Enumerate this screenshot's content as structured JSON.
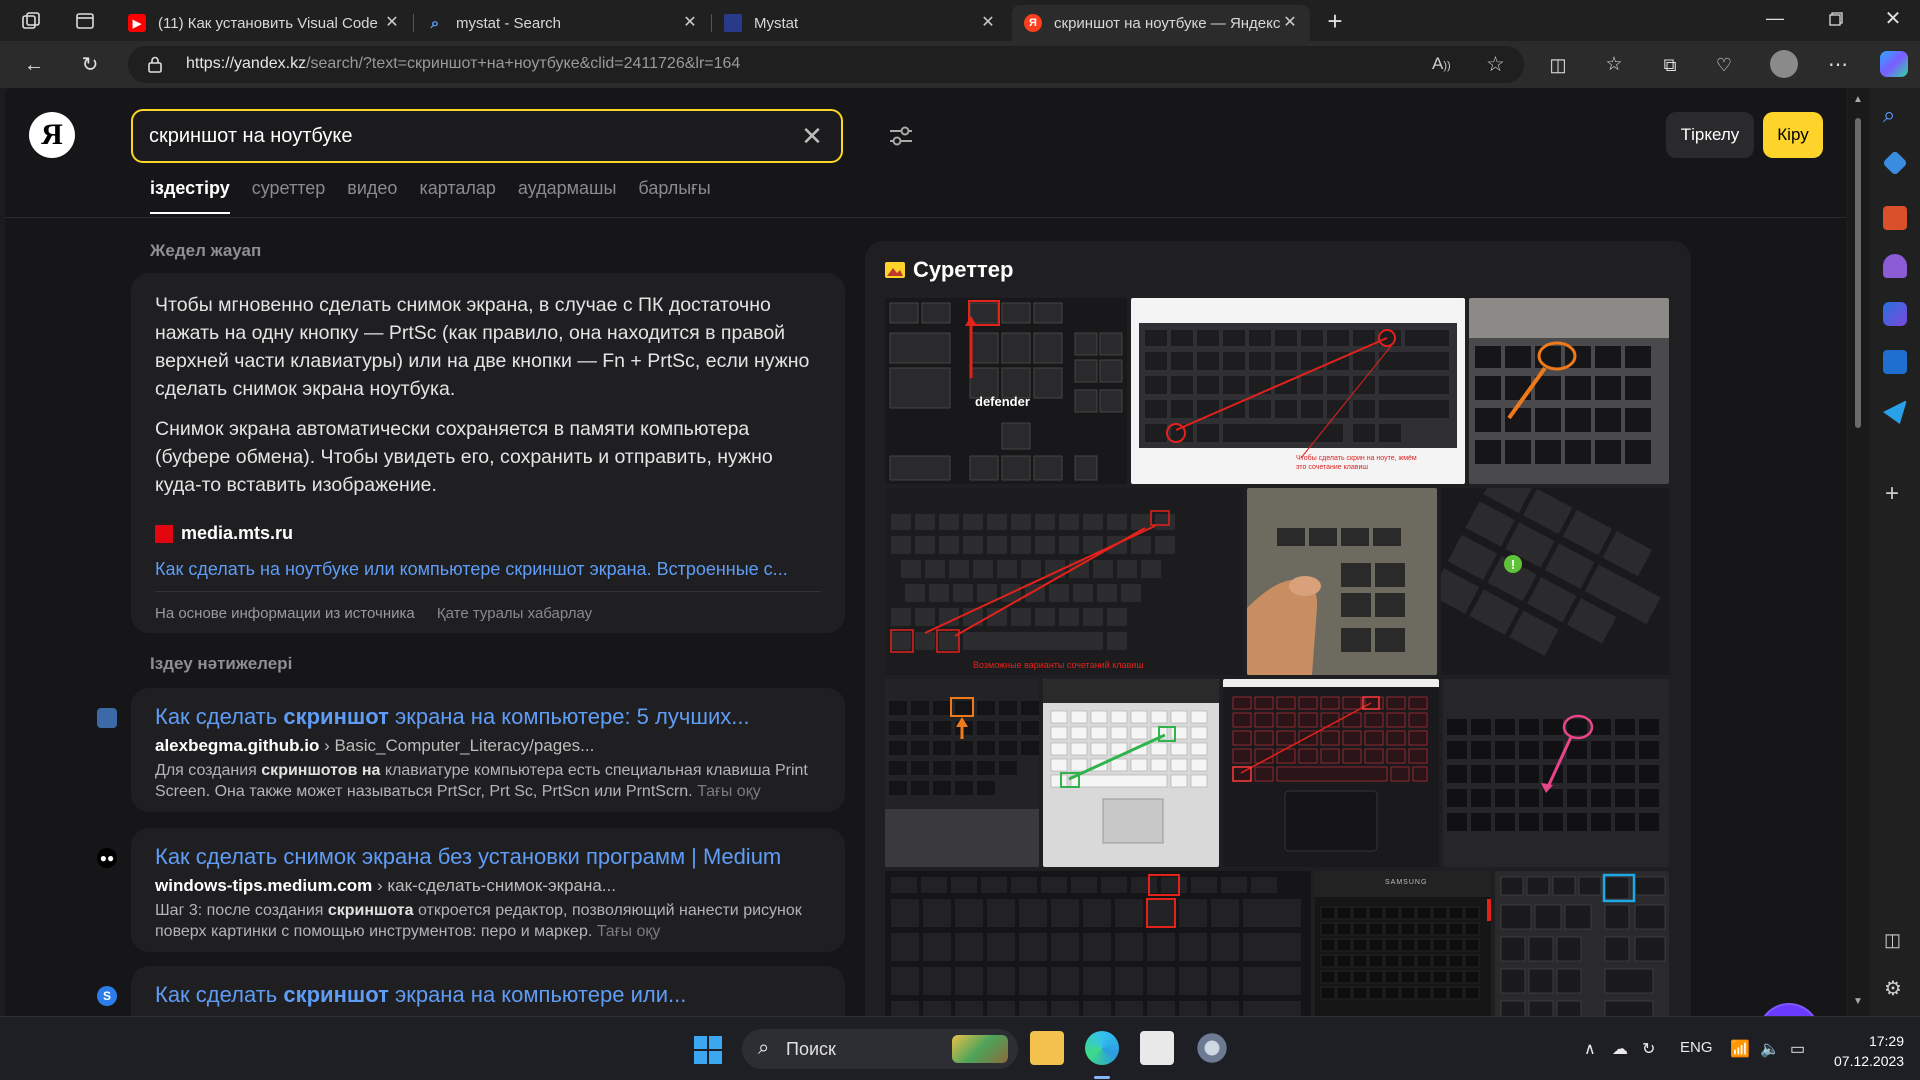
{
  "browser": {
    "tabs": [
      {
        "title": "(11) Как установить Visual Code",
        "favicon": "youtube-icon"
      },
      {
        "title": "mystat - Search",
        "favicon": "search-icon"
      },
      {
        "title": "Mystat",
        "favicon": "mystat-icon"
      },
      {
        "title": "скриншот на ноутбуке — Яндекс",
        "favicon": "yandex-icon",
        "active": true
      }
    ],
    "url_host": "https://yandex.kz",
    "url_rest": "/search/?text=скриншот+на+ноутбуке&clid=2411726&lr=164"
  },
  "header": {
    "logo": "Я",
    "query": "скриншот на ноутбуке",
    "tabs": [
      "іздестіру",
      "суреттер",
      "видео",
      "карталар",
      "аудармашы",
      "барлығы"
    ],
    "register_label": "Тіркелу",
    "login_label": "Кіру"
  },
  "quick_answer": {
    "heading": "Жедел жауап",
    "paragraph1": "Чтобы мгновенно сделать снимок экрана, в случае с ПК достаточно нажать на одну кнопку — PrtSc (как правило, она находится в правой верхней части клавиатуры) или на две кнопки — Fn + PrtSc, если нужно сделать снимок экрана ноутбука.",
    "paragraph2": "Снимок экрана автоматически сохраняется в памяти компьютера (буфере обмена). Чтобы увидеть его, сохранить и отправить, нужно куда-то вставить изображение.",
    "source_domain": "media.mts.ru",
    "source_link": "Как сделать на ноутбуке или компьютере скриншот экрана. Встроенные с...",
    "footer_info": "На основе информации из источника",
    "footer_report": "Қате туралы хабарлау"
  },
  "results": {
    "heading": "Іздеу нәтижелері",
    "items": [
      {
        "title_pre": "Как сделать ",
        "title_bold": "скриншот",
        "title_post": " экрана на компьютере: 5 лучших...",
        "domain": "alexbegma.github.io",
        "path": " › Basic_Computer_Literacy/pages...",
        "snippet_pre": "Для создания ",
        "snippet_bold": "скриншотов на",
        "snippet_post": " клавиатуре компьютера есть специальная клавиша Print Screen. Она также может называться PrtScr, Prt Sc, PrtScn или PrntScrn.",
        "more": "Тағы оқу"
      },
      {
        "title_pre": "Как сделать снимок экрана без установки программ | Medium",
        "title_bold": "",
        "title_post": "",
        "domain": "windows-tips.medium.com",
        "path": " › как-сделать-снимок-экрана...",
        "snippet_pre": "Шаг 3: после создания ",
        "snippet_bold": "скриншота",
        "snippet_post": " откроется редактор, позволяющий нанести рисунок поверх картинки с помощью инструментов: перо и маркер.",
        "more": "Тағы оқу"
      },
      {
        "title_pre": "Как сделать ",
        "title_bold": "скриншот",
        "title_post": " экрана на компьютере или...",
        "domain": "",
        "path": "",
        "snippet_pre": "",
        "snippet_bold": "",
        "snippet_post": "",
        "more": ""
      }
    ]
  },
  "images": {
    "heading": "Суреттер",
    "captions": [
      "defender",
      "Чтобы сделать скрин на ноуте, жмём это сочетание клавиш",
      "Возможные варианты сочетаний клавиш",
      "SAMSUNG"
    ]
  },
  "taskbar": {
    "search_label": "Поиск",
    "lang": "ENG",
    "time": "17:29",
    "date": "07.12.2023"
  },
  "colors": {
    "accent": "#fed42b",
    "link": "#5f9cf5",
    "page_bg": "#161618",
    "card_bg": "#1f1f22"
  }
}
